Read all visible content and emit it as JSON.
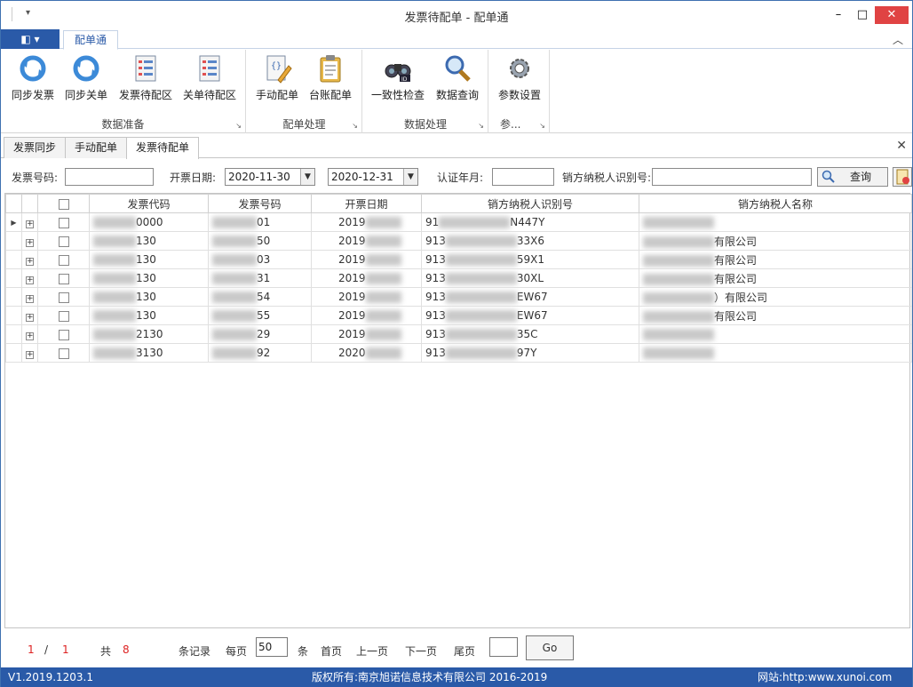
{
  "window": {
    "title": "发票待配单 - 配单通",
    "qa_glyph": "▾",
    "min": "–",
    "max": "□",
    "close": "✕"
  },
  "ribbon_tabs": {
    "file_glyph": "◧ ▾",
    "active": "配单通",
    "collapse": "︿"
  },
  "ribbon": {
    "groups": [
      {
        "label": "数据准备",
        "buttons": [
          "同步发票",
          "同步关单",
          "发票待配区",
          "关单待配区"
        ]
      },
      {
        "label": "配单处理",
        "buttons": [
          "手动配单",
          "台账配单"
        ]
      },
      {
        "label": "数据处理",
        "buttons": [
          "一致性检查",
          "数据查询"
        ]
      },
      {
        "label": "参...",
        "buttons": [
          "参数设置"
        ]
      }
    ],
    "launcher": "↘"
  },
  "doc_tabs": {
    "tabs": [
      "发票同步",
      "手动配单",
      "发票待配单"
    ],
    "close": "✕"
  },
  "filter": {
    "invoice_no_label": "发票号码:",
    "invoice_no_value": "",
    "date_label": "开票日期:",
    "date_from": "2020-11-30",
    "date_to": "2020-12-31",
    "cert_label": "认证年月:",
    "cert_value": "",
    "seller_label": "销方纳税人识别号:",
    "seller_value": "",
    "query_label": "查询"
  },
  "grid": {
    "headers": [
      "发票代码",
      "发票号码",
      "开票日期",
      "销方纳税人识别号",
      "销方纳税人名称"
    ],
    "rows": [
      {
        "code": "0000",
        "no": "01",
        "date": "2019",
        "tax": "91",
        "tax_tail": "N447Y",
        "name": ""
      },
      {
        "code": "130",
        "no": "50",
        "date": "2019",
        "tax": "913",
        "tax_tail": "33X6",
        "name": "有限公司"
      },
      {
        "code": "130",
        "no": "03",
        "date": "2019",
        "tax": "913",
        "tax_tail": "59X1",
        "name": "有限公司"
      },
      {
        "code": "130",
        "no": "31",
        "date": "2019",
        "tax": "913",
        "tax_tail": "30XL",
        "name": "有限公司"
      },
      {
        "code": "130",
        "no": "54",
        "date": "2019",
        "tax": "913",
        "tax_tail": "EW67",
        "name": "）有限公司"
      },
      {
        "code": "130",
        "no": "55",
        "date": "2019",
        "tax": "913",
        "tax_tail": "EW67",
        "name": "有限公司"
      },
      {
        "code": "2130",
        "no": "29",
        "date": "2019",
        "tax": "913",
        "tax_tail": "35C",
        "name": ""
      },
      {
        "code": "3130",
        "no": "92",
        "date": "2020",
        "tax": "913",
        "tax_tail": "97Y",
        "name": ""
      }
    ]
  },
  "pager": {
    "current": "1",
    "slash": "/",
    "total_pages": "1",
    "total_prefix": "共",
    "total_records": "8",
    "records_suffix": "条记录",
    "per_page_label": "每页",
    "per_page": "50",
    "per_page_unit": "条",
    "first": "首页",
    "prev": "上一页",
    "next": "下一页",
    "last": "尾页",
    "jump_value": "",
    "go": "Go"
  },
  "status": {
    "version": "V1.2019.1203.1",
    "copyright": "版权所有:南京旭诺信息技术有限公司 2016-2019",
    "website": "网站:http:www.xunoi.com"
  },
  "colors": {
    "accent": "#2a5aa8",
    "close": "#e04343",
    "red_text": "#d22222"
  }
}
